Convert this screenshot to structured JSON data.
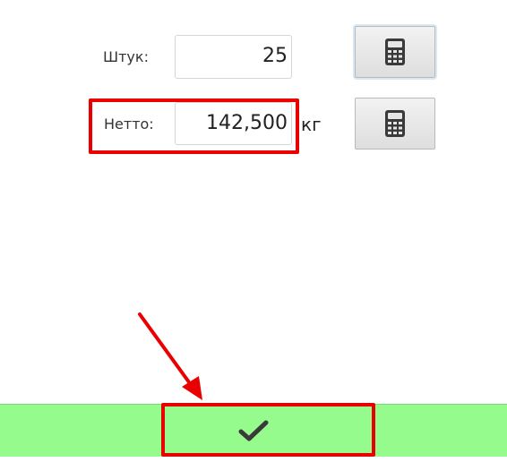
{
  "form": {
    "pieces_label": "Штук:",
    "pieces_value": "25",
    "net_label": "Нетто:",
    "net_value": "142,500",
    "net_unit": "кг"
  },
  "icons": {
    "calculator": "calculator-icon",
    "confirm": "checkmark-icon"
  },
  "colors": {
    "confirm_bar": "#94fb8c",
    "annotation": "#ea0000",
    "icon": "#3a3a3a"
  }
}
